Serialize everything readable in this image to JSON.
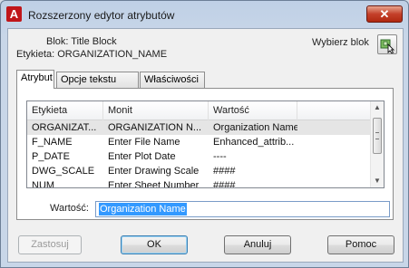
{
  "window": {
    "title": "Rozszerzony edytor atrybutów",
    "app_icon_letter": "A",
    "close_glyph": "✕"
  },
  "info": {
    "block_label": "Blok: Title Block",
    "tag_label": "Etykieta: ORGANIZATION_NAME"
  },
  "pick_block": {
    "label": "Wybierz blok",
    "icon": "select-block-icon"
  },
  "tabs": [
    {
      "label": "Atrybut",
      "active": true
    },
    {
      "label": "Opcje tekstu",
      "active": false
    },
    {
      "label": "Właściwości",
      "active": false
    }
  ],
  "grid": {
    "headers": [
      "Etykieta",
      "Monit",
      "Wartość",
      ""
    ],
    "rows": [
      {
        "tag": "ORGANIZAT...",
        "prompt": "ORGANIZATION N...",
        "value": "Organization Name",
        "selected": true
      },
      {
        "tag": "F_NAME",
        "prompt": "Enter File Name",
        "value": "Enhanced_attrib...",
        "selected": false
      },
      {
        "tag": "P_DATE",
        "prompt": "Enter Plot Date",
        "value": "----",
        "selected": false
      },
      {
        "tag": "DWG_SCALE",
        "prompt": "Enter Drawing Scale",
        "value": "####",
        "selected": false
      },
      {
        "tag": "NUM",
        "prompt": "Enter Sheet Number",
        "value": "####",
        "selected": false
      }
    ]
  },
  "value_field": {
    "label": "Wartość:",
    "value": "Organization Name"
  },
  "buttons": {
    "apply": "Zastosuj",
    "ok": "OK",
    "cancel": "Anuluj",
    "help": "Pomoc"
  }
}
